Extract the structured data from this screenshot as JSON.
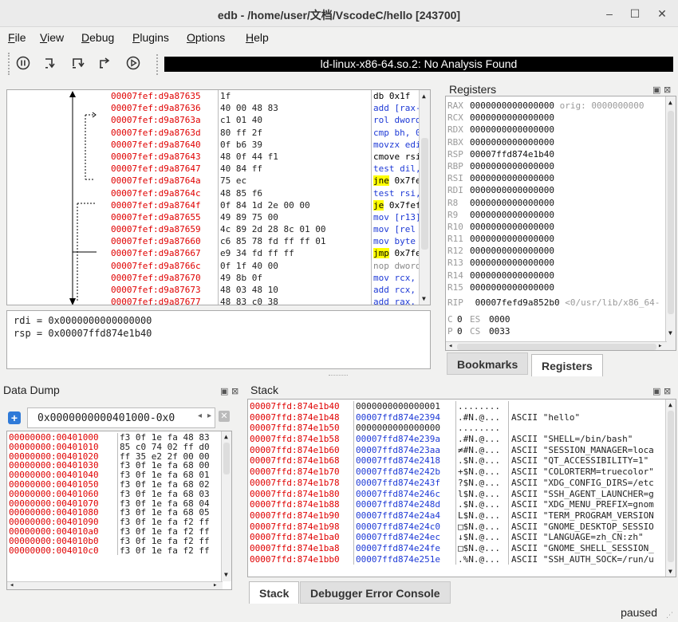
{
  "window": {
    "title": "edb - /home/user/文档/VscodeC/hello [243700]",
    "minimize": "–",
    "maximize": "☐",
    "close": "✕"
  },
  "menu": [
    "File",
    "View",
    "Debug",
    "Plugins",
    "Options",
    "Help"
  ],
  "toolbar": {
    "analysis_text": "ld-linux-x86-64.so.2: No Analysis Found"
  },
  "cpu": {
    "rows": [
      {
        "addr": "00007fef:d9a87635",
        "bytes": "1f",
        "ins": "db 0x1f",
        "kind": "black"
      },
      {
        "addr": "00007fef:d9a87636",
        "bytes": "40 00 48 83",
        "ins": "add [rax-",
        "kind": "blue"
      },
      {
        "addr": "00007fef:d9a8763a",
        "bytes": "c1 01 40",
        "ins": "rol dword",
        "kind": "blue"
      },
      {
        "addr": "00007fef:d9a8763d",
        "bytes": "80 ff 2f",
        "ins": "cmp bh, 0",
        "kind": "blue"
      },
      {
        "addr": "00007fef:d9a87640",
        "bytes": "0f b6 39",
        "ins": "movzx edi",
        "kind": "blue"
      },
      {
        "addr": "00007fef:d9a87643",
        "bytes": "48 0f 44 f1",
        "ins": "cmove rsi",
        "kind": "black"
      },
      {
        "addr": "00007fef:d9a87647",
        "bytes": "40 84 ff",
        "ins": "test dil,",
        "kind": "blue"
      },
      {
        "addr": "00007fef:d9a8764a",
        "bytes": "75 ec",
        "ins": "jne 0x7fe",
        "kind": "jump",
        "mn": "jne",
        "rest": " 0x7fe"
      },
      {
        "addr": "00007fef:d9a8764c",
        "bytes": "48 85 f6",
        "ins": "test rsi,",
        "kind": "blue"
      },
      {
        "addr": "00007fef:d9a8764f",
        "bytes": "0f 84 1d 2e 00 00",
        "ins": "je 0x7fef",
        "kind": "jump",
        "mn": "je",
        "rest": " 0x7fef"
      },
      {
        "addr": "00007fef:d9a87655",
        "bytes": "49 89 75 00",
        "ins": "mov [r13]",
        "kind": "blue"
      },
      {
        "addr": "00007fef:d9a87659",
        "bytes": "4c 89 2d 28 8c 01 00",
        "ins": "mov [rel",
        "kind": "blue"
      },
      {
        "addr": "00007fef:d9a87660",
        "bytes": "c6 85 78 fd ff ff 01",
        "ins": "mov byte",
        "kind": "blue"
      },
      {
        "addr": "00007fef:d9a87667",
        "bytes": "e9 34 fd ff ff",
        "ins": "jmp 0x7fe",
        "kind": "jump",
        "mn": "jmp",
        "rest": " 0x7fe"
      },
      {
        "addr": "00007fef:d9a8766c",
        "bytes": "0f 1f 40 00",
        "ins": "nop dword",
        "kind": "grey"
      },
      {
        "addr": "00007fef:d9a87670",
        "bytes": "49 8b 0f",
        "ins": "mov rcx,",
        "kind": "blue"
      },
      {
        "addr": "00007fef:d9a87673",
        "bytes": "48 03 48 10",
        "ins": "add rcx,",
        "kind": "blue"
      },
      {
        "addr": "00007fef:d9a87677",
        "bytes": "48 83 c0 38",
        "ins": "add rax,",
        "kind": "blue"
      }
    ]
  },
  "regview": [
    "rdi = 0x0000000000000000",
    "rsp = 0x00007ffd874e1b40"
  ],
  "registers": {
    "title": "Registers",
    "rows": [
      {
        "name": "RAX",
        "val": "0000000000000000",
        "extra": " orig: 0000000000"
      },
      {
        "name": "RCX",
        "val": "0000000000000000",
        "extra": ""
      },
      {
        "name": "RDX",
        "val": "0000000000000000",
        "extra": ""
      },
      {
        "name": "RBX",
        "val": "0000000000000000",
        "extra": ""
      },
      {
        "name": "RSP",
        "val": "00007ffd874e1b40",
        "extra": ""
      },
      {
        "name": "RBP",
        "val": "0000000000000000",
        "extra": ""
      },
      {
        "name": "RSI",
        "val": "0000000000000000",
        "extra": ""
      },
      {
        "name": "RDI",
        "val": "0000000000000000",
        "extra": ""
      },
      {
        "name": "R8",
        "val": "0000000000000000",
        "extra": ""
      },
      {
        "name": "R9",
        "val": "0000000000000000",
        "extra": ""
      },
      {
        "name": "R10",
        "val": "0000000000000000",
        "extra": ""
      },
      {
        "name": "R11",
        "val": "0000000000000000",
        "extra": ""
      },
      {
        "name": "R12",
        "val": "0000000000000000",
        "extra": ""
      },
      {
        "name": "R13",
        "val": "0000000000000000",
        "extra": ""
      },
      {
        "name": "R14",
        "val": "0000000000000000",
        "extra": ""
      },
      {
        "name": "R15",
        "val": "0000000000000000",
        "extra": ""
      }
    ],
    "rip_name": "RIP",
    "rip_val": "00007fefd9a852b0",
    "rip_extra": " <0/usr/lib/x86_64-",
    "flags": [
      {
        "a": "C",
        "b": "0",
        "c": "ES",
        "d": "0000"
      },
      {
        "a": "P",
        "b": "0",
        "c": "CS",
        "d": "0033"
      }
    ]
  },
  "tabs_right": {
    "bookmarks": "Bookmarks",
    "registers": "Registers"
  },
  "datadump": {
    "title": "Data Dump",
    "tab_addr": "0x0000000000401000-0x0",
    "rows": [
      {
        "addr": "00000000:00401000",
        "bytes": "f3 0f 1e fa 48 83"
      },
      {
        "addr": "00000000:00401010",
        "bytes": "85 c0 74 02 ff d0"
      },
      {
        "addr": "00000000:00401020",
        "bytes": "ff 35 e2 2f 00 00"
      },
      {
        "addr": "00000000:00401030",
        "bytes": "f3 0f 1e fa 68 00"
      },
      {
        "addr": "00000000:00401040",
        "bytes": "f3 0f 1e fa 68 01"
      },
      {
        "addr": "00000000:00401050",
        "bytes": "f3 0f 1e fa 68 02"
      },
      {
        "addr": "00000000:00401060",
        "bytes": "f3 0f 1e fa 68 03"
      },
      {
        "addr": "00000000:00401070",
        "bytes": "f3 0f 1e fa 68 04"
      },
      {
        "addr": "00000000:00401080",
        "bytes": "f3 0f 1e fa 68 05"
      },
      {
        "addr": "00000000:00401090",
        "bytes": "f3 0f 1e fa f2 ff"
      },
      {
        "addr": "00000000:004010a0",
        "bytes": "f3 0f 1e fa f2 ff"
      },
      {
        "addr": "00000000:004010b0",
        "bytes": "f3 0f 1e fa f2 ff"
      },
      {
        "addr": "00000000:004010c0",
        "bytes": "f3 0f 1e fa f2 ff"
      }
    ]
  },
  "stack": {
    "title": "Stack",
    "rows": [
      {
        "addr": "00007ffd:874e1b40",
        "val": "0000000000000001",
        "ascii": "........",
        "comment": "",
        "blue": false
      },
      {
        "addr": "00007ffd:874e1b48",
        "val": "00007ffd874e2394",
        "ascii": ".#N.@...",
        "comment": "ASCII \"hello\"",
        "blue": true
      },
      {
        "addr": "00007ffd:874e1b50",
        "val": "0000000000000000",
        "ascii": "........",
        "comment": "",
        "blue": false
      },
      {
        "addr": "00007ffd:874e1b58",
        "val": "00007ffd874e239a",
        "ascii": ".#N.@...",
        "comment": "ASCII \"SHELL=/bin/bash\"",
        "blue": true
      },
      {
        "addr": "00007ffd:874e1b60",
        "val": "00007ffd874e23aa",
        "ascii": "≠#N.@...",
        "comment": "ASCII \"SESSION_MANAGER=loca",
        "blue": true
      },
      {
        "addr": "00007ffd:874e1b68",
        "val": "00007ffd874e2418",
        "ascii": ".$N.@...",
        "comment": "ASCII \"QT_ACCESSIBILITY=1\"",
        "blue": true
      },
      {
        "addr": "00007ffd:874e1b70",
        "val": "00007ffd874e242b",
        "ascii": "+$N.@...",
        "comment": "ASCII \"COLORTERM=truecolor\"",
        "blue": true
      },
      {
        "addr": "00007ffd:874e1b78",
        "val": "00007ffd874e243f",
        "ascii": "?$N.@...",
        "comment": "ASCII \"XDG_CONFIG_DIRS=/etc",
        "blue": true
      },
      {
        "addr": "00007ffd:874e1b80",
        "val": "00007ffd874e246c",
        "ascii": "l$N.@...",
        "comment": "ASCII \"SSH_AGENT_LAUNCHER=g",
        "blue": true
      },
      {
        "addr": "00007ffd:874e1b88",
        "val": "00007ffd874e248d",
        "ascii": ".$N.@...",
        "comment": "ASCII \"XDG_MENU_PREFIX=gnom",
        "blue": true
      },
      {
        "addr": "00007ffd:874e1b90",
        "val": "00007ffd874e24a4",
        "ascii": "L$N.@...",
        "comment": "ASCII \"TERM_PROGRAM_VERSION",
        "blue": true
      },
      {
        "addr": "00007ffd:874e1b98",
        "val": "00007ffd874e24c0",
        "ascii": "□$N.@...",
        "comment": "ASCII \"GNOME_DESKTOP_SESSIO",
        "blue": true
      },
      {
        "addr": "00007ffd:874e1ba0",
        "val": "00007ffd874e24ec",
        "ascii": "↓$N.@...",
        "comment": "ASCII \"LANGUAGE=zh_CN:zh\"",
        "blue": true
      },
      {
        "addr": "00007ffd:874e1ba8",
        "val": "00007ffd874e24fe",
        "ascii": "□$N.@...",
        "comment": "ASCII \"GNOME_SHELL_SESSION_",
        "blue": true
      },
      {
        "addr": "00007ffd:874e1bb0",
        "val": "00007ffd874e251e",
        "ascii": ".%N.@...",
        "comment": "ASCII \"SSH_AUTH_SOCK=/run/u",
        "blue": true
      }
    ]
  },
  "tabs_bottom": {
    "stack": "Stack",
    "console": "Debugger Error Console"
  },
  "status": "paused",
  "colors": {
    "address_red": "#e00000",
    "value_blue": "#1e3ad6",
    "jump_highlight": "#ffff00"
  }
}
